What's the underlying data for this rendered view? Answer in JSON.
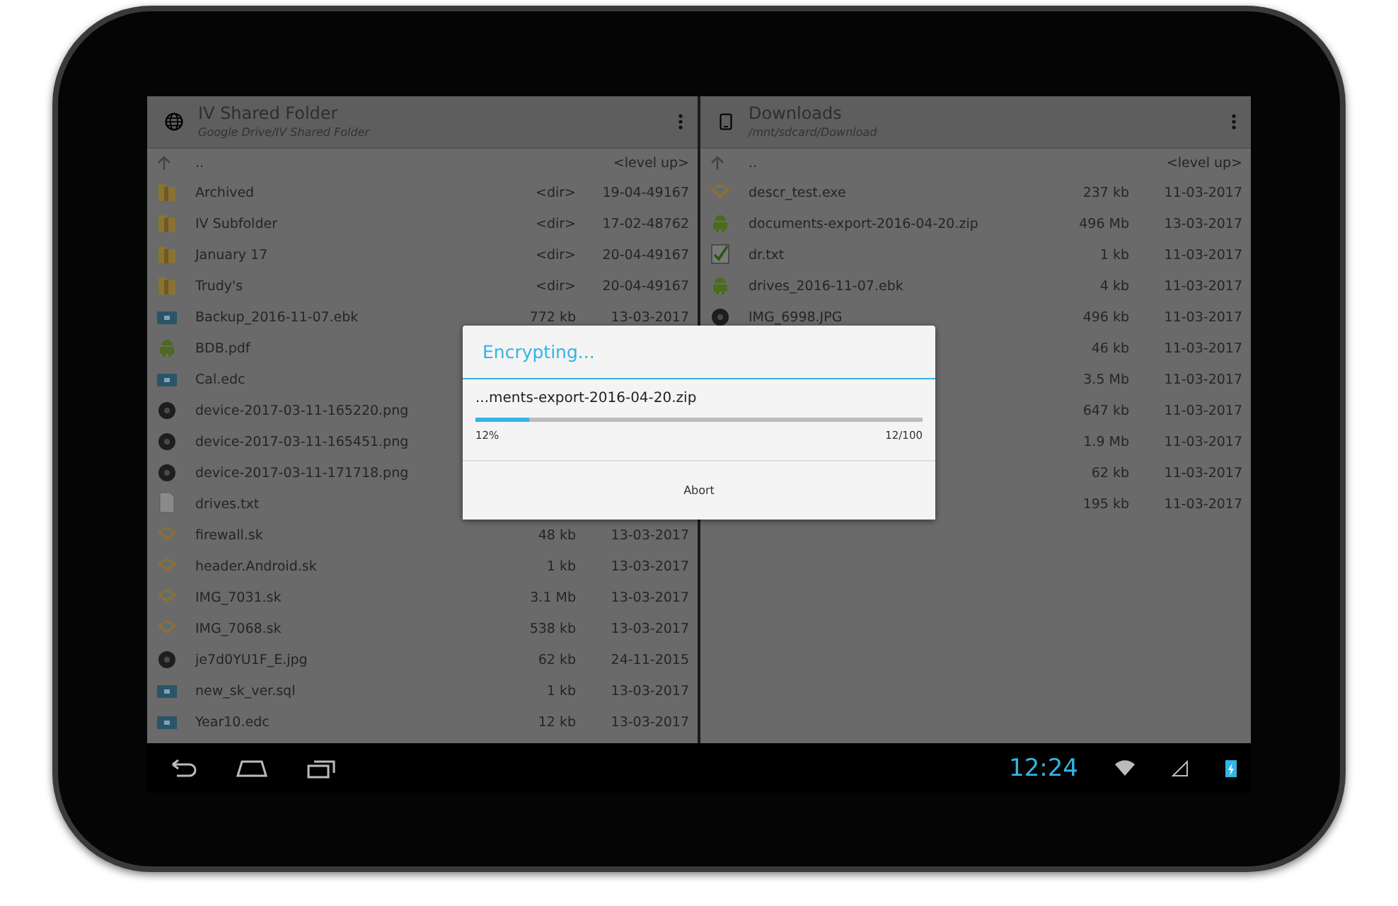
{
  "panels": [
    {
      "title": "IV Shared Folder",
      "path": "Google Drive/IV Shared Folder",
      "kind": "globe",
      "level_up": {
        "name": "..",
        "label": "<level up>"
      },
      "rows": [
        {
          "kind": "folder",
          "name": "Archived",
          "size": "<dir>",
          "date": "19-04-49167"
        },
        {
          "kind": "folder",
          "name": "IV Subfolder",
          "size": "<dir>",
          "date": "17-02-48762"
        },
        {
          "kind": "folder",
          "name": "January 17",
          "size": "<dir>",
          "date": "20-04-49167"
        },
        {
          "kind": "folder",
          "name": "Trudy's",
          "size": "<dir>",
          "date": "20-04-49167"
        },
        {
          "kind": "archive",
          "name": "Backup_2016-11-07.ebk",
          "size": "772 kb",
          "date": "13-03-2017"
        },
        {
          "kind": "android",
          "name": "BDB.pdf"
        },
        {
          "kind": "archive",
          "name": "Cal.edc"
        },
        {
          "kind": "image",
          "name": "device-2017-03-11-165220.png"
        },
        {
          "kind": "image",
          "name": "device-2017-03-11-165451.png"
        },
        {
          "kind": "image",
          "name": "device-2017-03-11-171718.png"
        },
        {
          "kind": "text",
          "name": "drives.txt"
        },
        {
          "kind": "package",
          "name": "firewall.sk",
          "size": "48 kb",
          "date": "13-03-2017"
        },
        {
          "kind": "package",
          "name": "header.Android.sk",
          "size": "1 kb",
          "date": "13-03-2017"
        },
        {
          "kind": "package",
          "name": "IMG_7031.sk",
          "size": "3.1 Mb",
          "date": "13-03-2017"
        },
        {
          "kind": "package",
          "name": "IMG_7068.sk",
          "size": "538 kb",
          "date": "13-03-2017"
        },
        {
          "kind": "image",
          "name": "je7d0YU1F_E.jpg",
          "size": "62 kb",
          "date": "24-11-2015"
        },
        {
          "kind": "archive",
          "name": "new_sk_ver.sql",
          "size": "1 kb",
          "date": "13-03-2017"
        },
        {
          "kind": "archive",
          "name": "Year10.edc",
          "size": "12 kb",
          "date": "13-03-2017"
        }
      ]
    },
    {
      "title": "Downloads",
      "path": "/mnt/sdcard/Download",
      "kind": "phone",
      "level_up": {
        "name": "..",
        "label": "<level up>"
      },
      "rows": [
        {
          "kind": "package",
          "name": "descr_test.exe",
          "size": "237 kb",
          "date": "11-03-2017"
        },
        {
          "kind": "android",
          "name": "documents-export-2016-04-20.zip",
          "size": "496 Mb",
          "date": "13-03-2017"
        },
        {
          "kind": "check",
          "name": "dr.txt",
          "size": "1 kb",
          "date": "11-03-2017"
        },
        {
          "kind": "android",
          "name": "drives_2016-11-07.ebk",
          "size": "4 kb",
          "date": "11-03-2017"
        },
        {
          "kind": "image",
          "name": "IMG_6998.JPG",
          "size": "496 kb",
          "date": "11-03-2017"
        },
        {
          "size": "46 kb",
          "date": "11-03-2017"
        },
        {
          "size": "3.5 Mb",
          "date": "11-03-2017"
        },
        {
          "size": "647 kb",
          "date": "11-03-2017"
        },
        {
          "size": "1.9 Mb",
          "date": "11-03-2017"
        },
        {
          "size": "62 kb",
          "date": "11-03-2017"
        },
        {
          "size": "195 kb",
          "date": "11-03-2017"
        }
      ]
    }
  ],
  "dialog": {
    "title": "Encrypting...",
    "file": "...ments-export-2016-04-20.zip",
    "level": 0.12,
    "percent": "12%",
    "count": "12/100",
    "button": "Abort"
  },
  "nav_bar": {
    "time": "12:24"
  }
}
